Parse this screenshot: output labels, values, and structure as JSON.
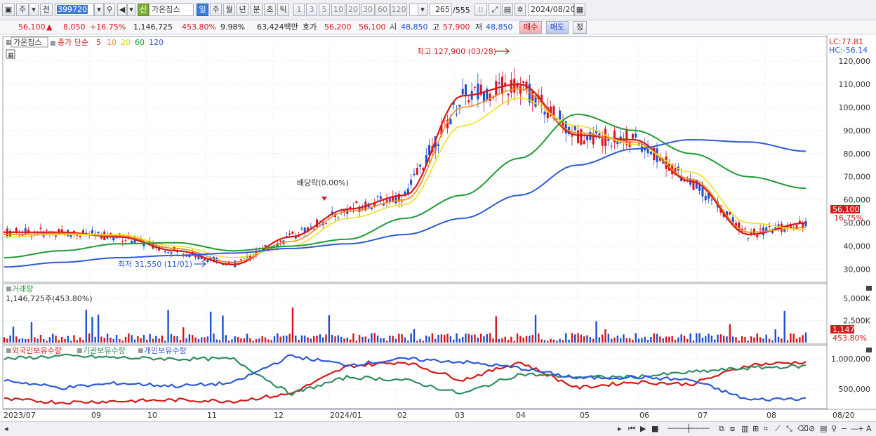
{
  "toolbar": {
    "period_code": "주",
    "market_label": "전",
    "stock_code": "399720",
    "new_badge": "신",
    "stock_name": "가온칩스",
    "intervals": [
      "일",
      "주",
      "월",
      "년",
      "분",
      "초",
      "틱"
    ],
    "active_interval": "일",
    "tick_counts": [
      "1",
      "3",
      "5",
      "10",
      "20",
      "30",
      "60",
      "120"
    ],
    "view_count": "265",
    "total_count": "/555",
    "date": "2024/08/20"
  },
  "quote": {
    "price": "56,100",
    "arrow": "▲",
    "change": "8,050",
    "change_pct": "+16.75%",
    "volume": "1,146,725",
    "volume_ratio": "453.80%",
    "turnover": "9.98%",
    "amount": "63,424백만",
    "bid_label": "호가",
    "bid1": "56,200",
    "bid2": "56,100",
    "open_label": "시",
    "open": "48,850",
    "high_label": "고",
    "high": "57,900",
    "low_label": "저",
    "low": "48,850",
    "buy_label": "매수",
    "sell_label": "매도",
    "extra_label": "정"
  },
  "price_panel": {
    "title_tag": "가온칩스",
    "legend_prefix": "종가 단순",
    "ma_labels": [
      "5",
      "10",
      "20",
      "60",
      "120"
    ],
    "lc": "LC:77.81",
    "hc": "HC:-56.14",
    "y_ticks": [
      "120,000",
      "110,000",
      "100,000",
      "90,000",
      "80,000",
      "70,000",
      "60,000",
      "50,000",
      "40,000",
      "30,000"
    ],
    "high_note": "최고 127,900 (03/28)",
    "low_note": "최저 31,550 (11/01)",
    "dividend_note": "배당락(0.00%)",
    "last_price": "56,100",
    "last_pct": "16.75%"
  },
  "volume_panel": {
    "title": "거래량",
    "value": "1,146,725주(453.80%)",
    "y_ticks": [
      "5,000K",
      "2,500K"
    ],
    "last_value": "1,147K",
    "last_pct": "453.80%"
  },
  "holdings_panel": {
    "legend": [
      "외국인보유수량",
      "기관보유수량",
      "개인보유수량"
    ],
    "y_ticks": [
      "1,000,000",
      "500,000"
    ]
  },
  "x_axis": {
    "labels": [
      "2023/07",
      "09",
      "10",
      "11",
      "12",
      "2024/01",
      "02",
      "03",
      "04",
      "05",
      "06",
      "07",
      "08",
      "08/20"
    ]
  },
  "colors": {
    "ma5": "#d81818",
    "ma10": "#f08c1e",
    "ma20": "#f0e020",
    "ma60": "#1f9b35",
    "ma120": "#2e5ad8",
    "up": "#d8141e",
    "down": "#1e4fd0",
    "foreign": "#d81818",
    "institution": "#2f8f60",
    "individual": "#2e5ad8"
  },
  "chart_data": {
    "type": "line",
    "title": "가온칩스",
    "ylim": [
      25000,
      130000
    ],
    "x": [
      "2023/07",
      "08",
      "09",
      "10",
      "11",
      "12",
      "2024/01",
      "02",
      "03",
      "04",
      "05",
      "06",
      "07",
      "08",
      "08/20"
    ],
    "series": [
      {
        "name": "5",
        "values": [
          46000,
          46000,
          44000,
          38000,
          32000,
          44000,
          56000,
          62000,
          105000,
          110000,
          88000,
          86000,
          68000,
          45000,
          50000
        ]
      },
      {
        "name": "10",
        "values": [
          45000,
          45500,
          44500,
          39000,
          33000,
          42000,
          55000,
          60000,
          100000,
          108000,
          89000,
          85000,
          69000,
          46000,
          48000
        ]
      },
      {
        "name": "20",
        "values": [
          44000,
          45000,
          45000,
          40000,
          35000,
          40000,
          52000,
          58000,
          92000,
          104000,
          92000,
          84000,
          72000,
          50000,
          47000
        ]
      },
      {
        "name": "60",
        "values": [
          35000,
          38000,
          41000,
          41500,
          38000,
          40000,
          43000,
          52000,
          62000,
          78000,
          97000,
          90000,
          80000,
          70000,
          65000
        ]
      },
      {
        "name": "120",
        "values": [
          31000,
          33000,
          35000,
          36000,
          37000,
          39000,
          41000,
          45000,
          52000,
          62000,
          75000,
          82000,
          86000,
          85000,
          81000
        ]
      }
    ]
  }
}
